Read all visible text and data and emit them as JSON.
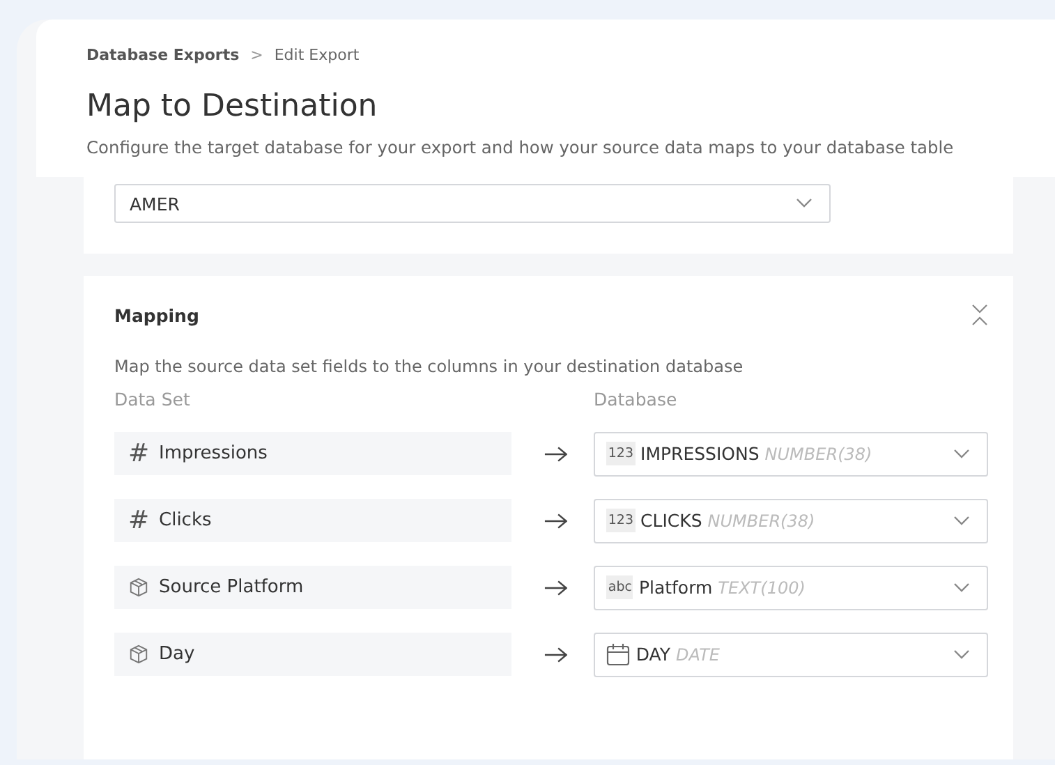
{
  "breadcrumb": {
    "items": [
      "Database Exports",
      "Edit Export"
    ],
    "separator": ">"
  },
  "title": "Map to Destination",
  "subtitle": "Configure the target database for your export and how your source data maps to your database table",
  "region_select": {
    "value": "AMER"
  },
  "mapping": {
    "title": "Mapping",
    "expanded": true,
    "description": "Map the source data set fields to the columns in your destination database",
    "columns": [
      "Data Set",
      "Database"
    ],
    "rows": [
      {
        "source": {
          "kind": "measure",
          "icon": "#",
          "name": "Impressions"
        },
        "target": {
          "kind": "number",
          "badge": "123",
          "name": "IMPRESSIONS",
          "type": "NUMBER(38)"
        }
      },
      {
        "source": {
          "kind": "measure",
          "icon": "#",
          "name": "Clicks"
        },
        "target": {
          "kind": "number",
          "badge": "123",
          "name": "CLICKS",
          "type": "NUMBER(38)"
        }
      },
      {
        "source": {
          "kind": "dimension",
          "name": "Source Platform"
        },
        "target": {
          "kind": "text",
          "badge": "abc",
          "name": "Platform",
          "type": "TEXT(100)"
        }
      },
      {
        "source": {
          "kind": "dimension",
          "name": "Day"
        },
        "target": {
          "kind": "date",
          "name": "DAY",
          "type": "DATE"
        }
      }
    ]
  }
}
